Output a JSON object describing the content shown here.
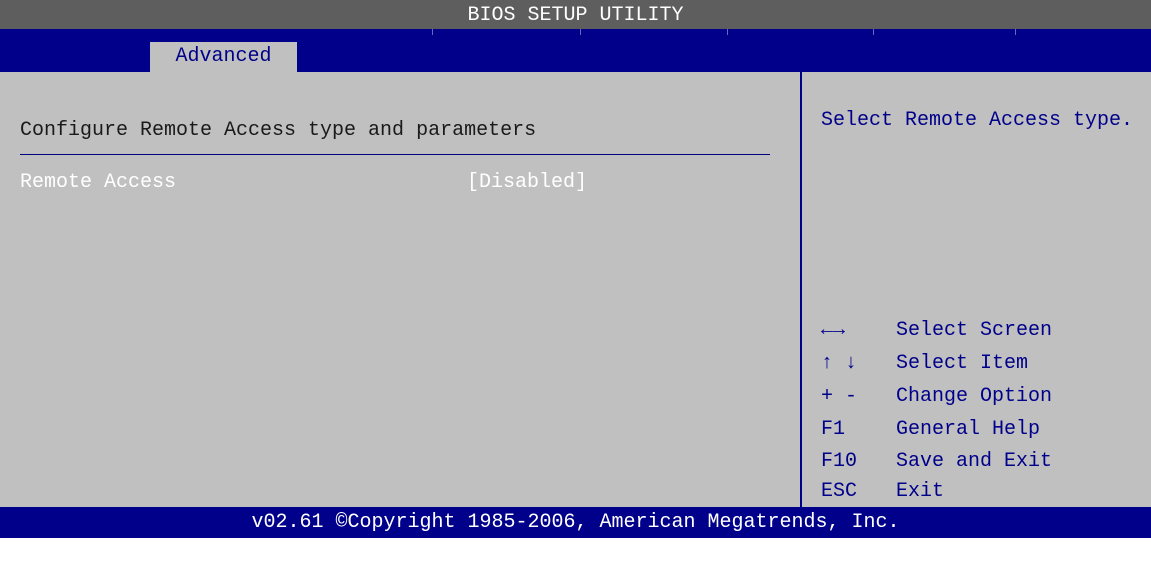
{
  "header": {
    "title": "BIOS SETUP UTILITY"
  },
  "tabs": [
    {
      "label": "Advanced",
      "active": true
    }
  ],
  "main": {
    "heading": "Configure Remote Access type and parameters",
    "items": [
      {
        "label": "Remote Access",
        "value": "[Disabled]",
        "selected": true
      }
    ]
  },
  "help": {
    "description": "Select Remote Access type.",
    "keys": [
      {
        "key": "←→",
        "action": "Select Screen"
      },
      {
        "key": "↑ ↓",
        "action": "Select Item"
      },
      {
        "key": "+ -",
        "action": "Change Option"
      },
      {
        "key": "F1",
        "action": "General Help"
      },
      {
        "key": "F10",
        "action": "Save and Exit"
      },
      {
        "key": "ESC",
        "action": "Exit"
      }
    ]
  },
  "footer": {
    "copyright": "v02.61 ©Copyright 1985-2006, American Megatrends, Inc."
  },
  "colors": {
    "background": "#c0c0c0",
    "bar": "#00008a",
    "title_bar": "#5e5e5e",
    "text_blue": "#00008a",
    "highlight": "#ffffff"
  }
}
